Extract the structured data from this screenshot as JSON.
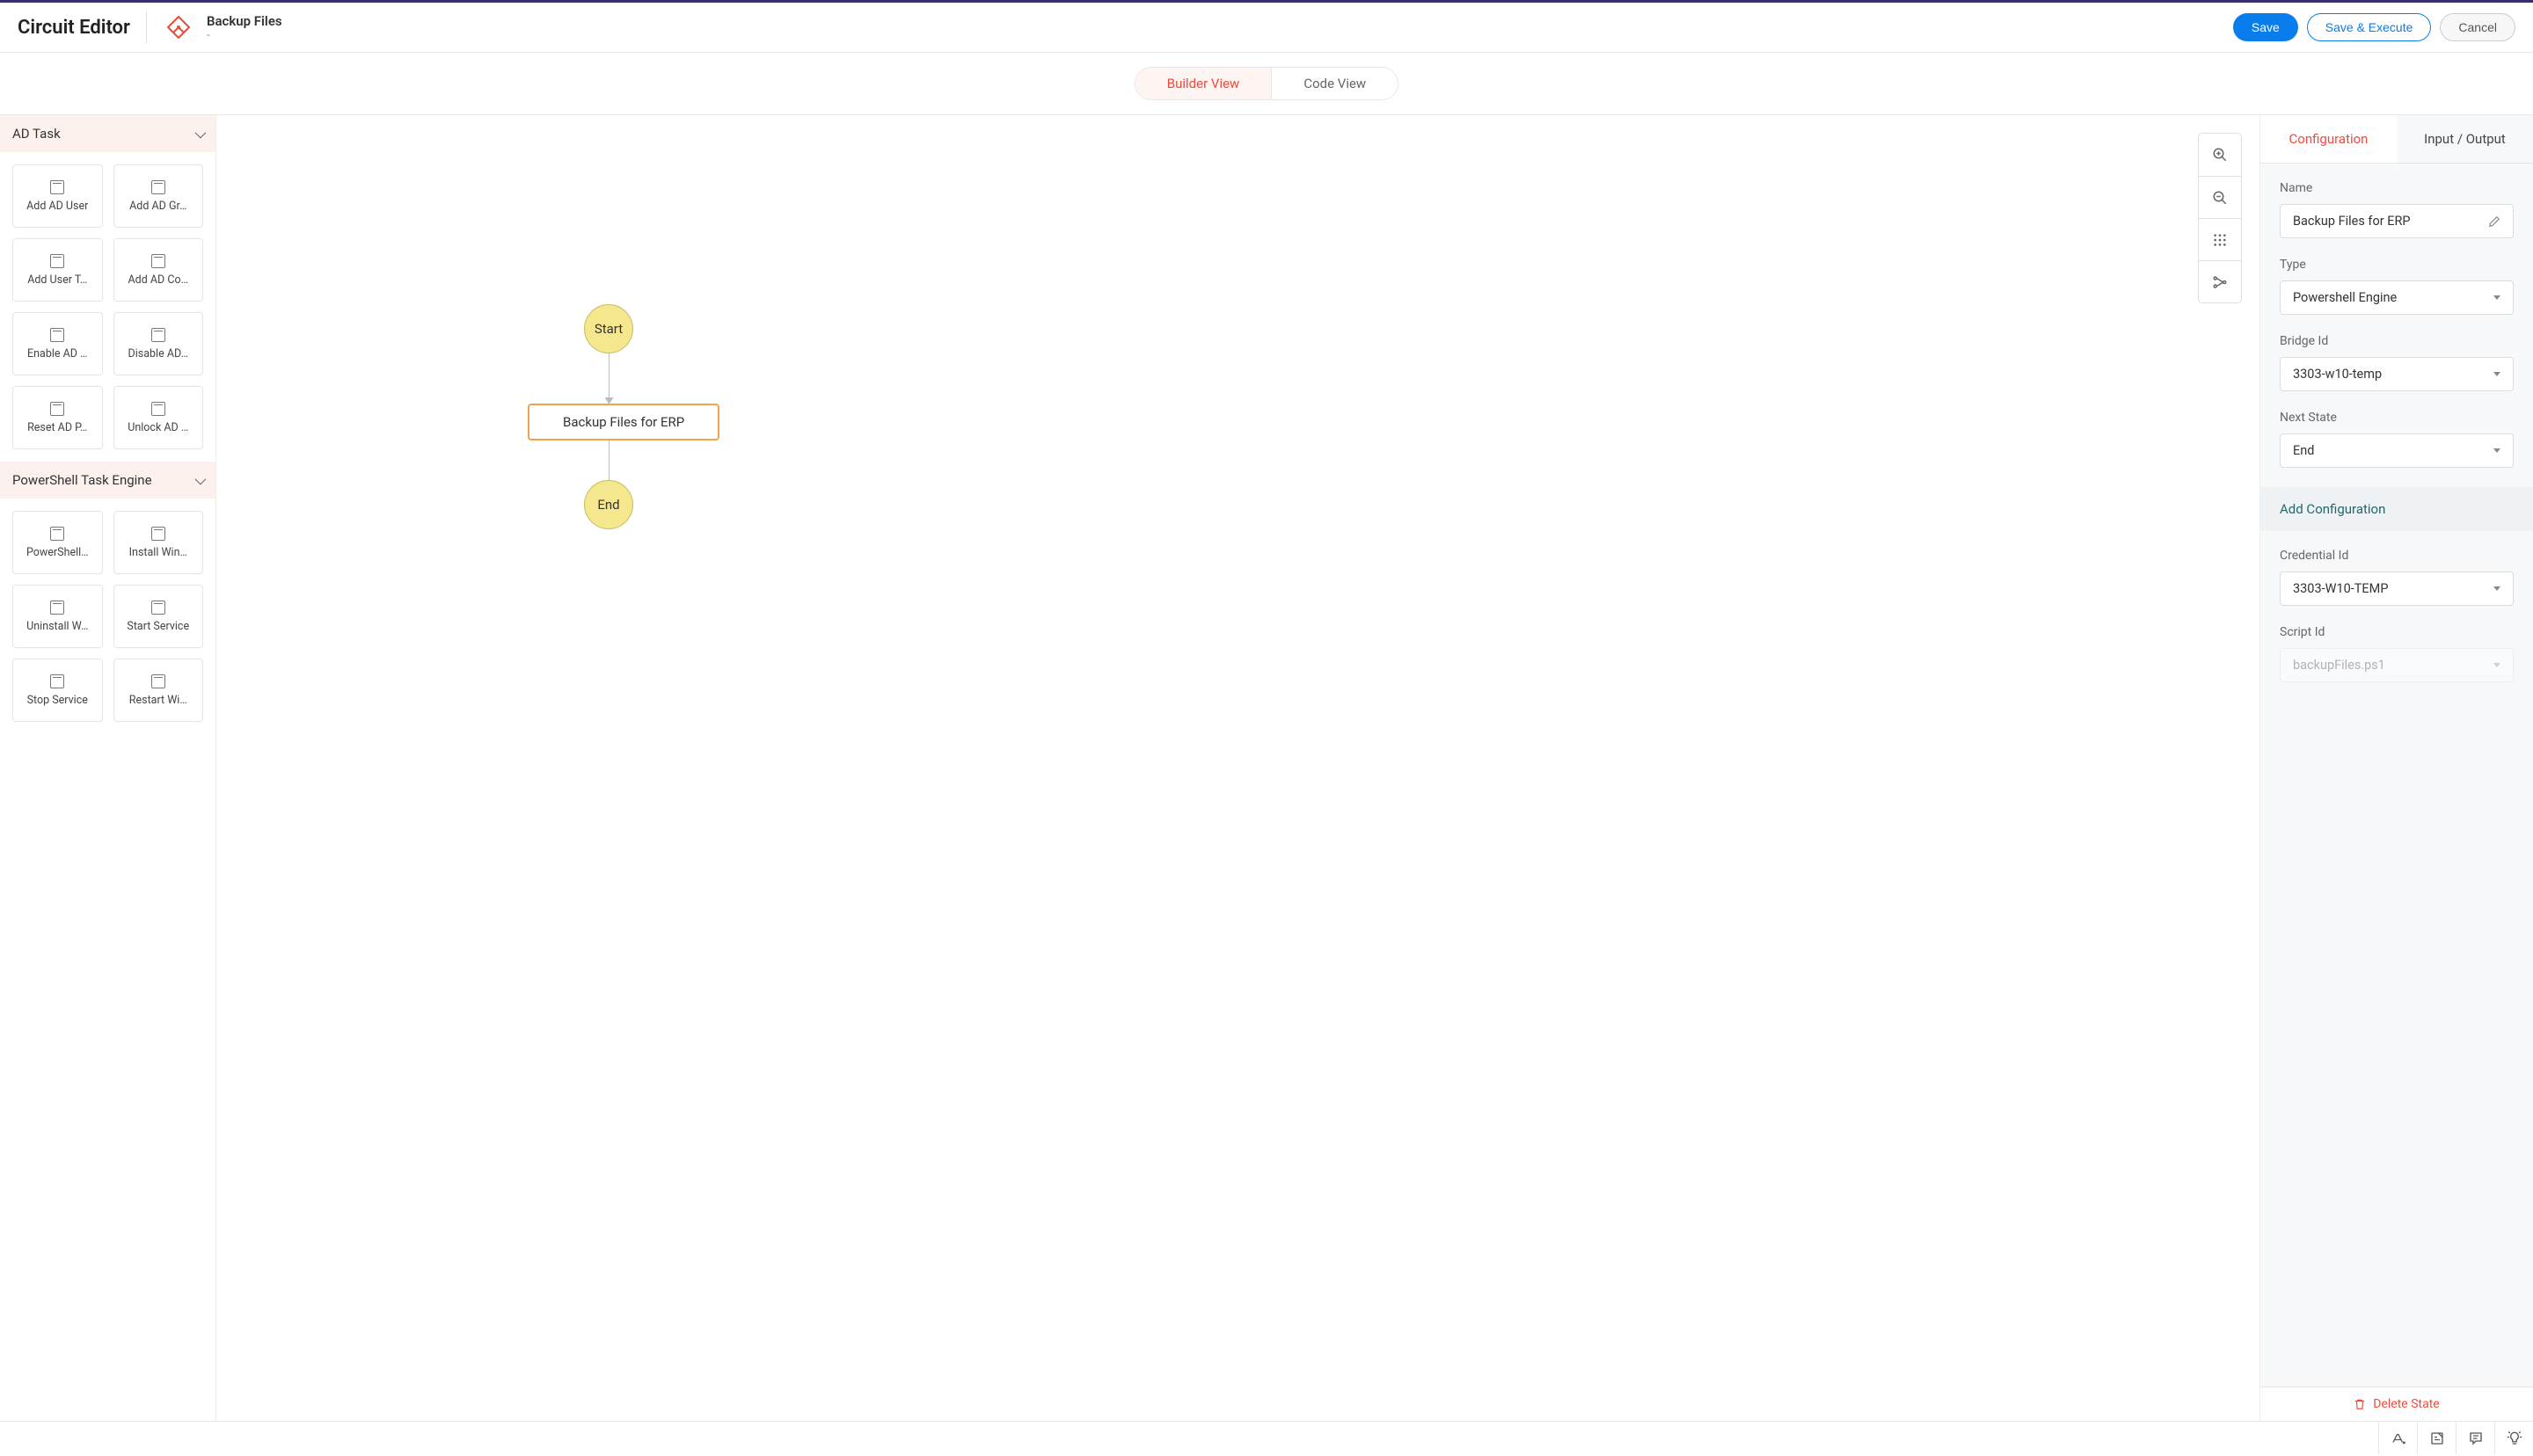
{
  "header": {
    "app_title": "Circuit Editor",
    "doc_title": "Backup Files",
    "doc_sub": "-",
    "save": "Save",
    "save_execute": "Save & Execute",
    "cancel": "Cancel"
  },
  "view_tabs": {
    "builder": "Builder View",
    "code": "Code View"
  },
  "sidebar": {
    "categories": [
      {
        "title": "AD Task",
        "tasks": [
          "Add AD User",
          "Add AD Gr…",
          "Add User T…",
          "Add AD Co…",
          "Enable AD …",
          "Disable AD…",
          "Reset AD P…",
          "Unlock AD …"
        ]
      },
      {
        "title": "PowerShell Task Engine",
        "tasks": [
          "PowerShell…",
          "Install Win…",
          "Uninstall W…",
          "Start Service",
          "Stop Service",
          "Restart Wi…"
        ]
      }
    ]
  },
  "flow": {
    "start": "Start",
    "middle": "Backup Files for ERP",
    "end": "End"
  },
  "right_panel": {
    "tabs": {
      "config": "Configuration",
      "io": "Input / Output"
    },
    "name_label": "Name",
    "name_value": "Backup Files for ERP",
    "type_label": "Type",
    "type_value": "Powershell Engine",
    "bridge_label": "Bridge Id",
    "bridge_value": "3303-w10-temp",
    "next_label": "Next State",
    "next_value": "End",
    "add_config": "Add Configuration",
    "cred_label": "Credential Id",
    "cred_value": "3303-W10-TEMP",
    "script_label": "Script Id",
    "script_value": "backupFiles.ps1",
    "delete": "Delete State"
  }
}
